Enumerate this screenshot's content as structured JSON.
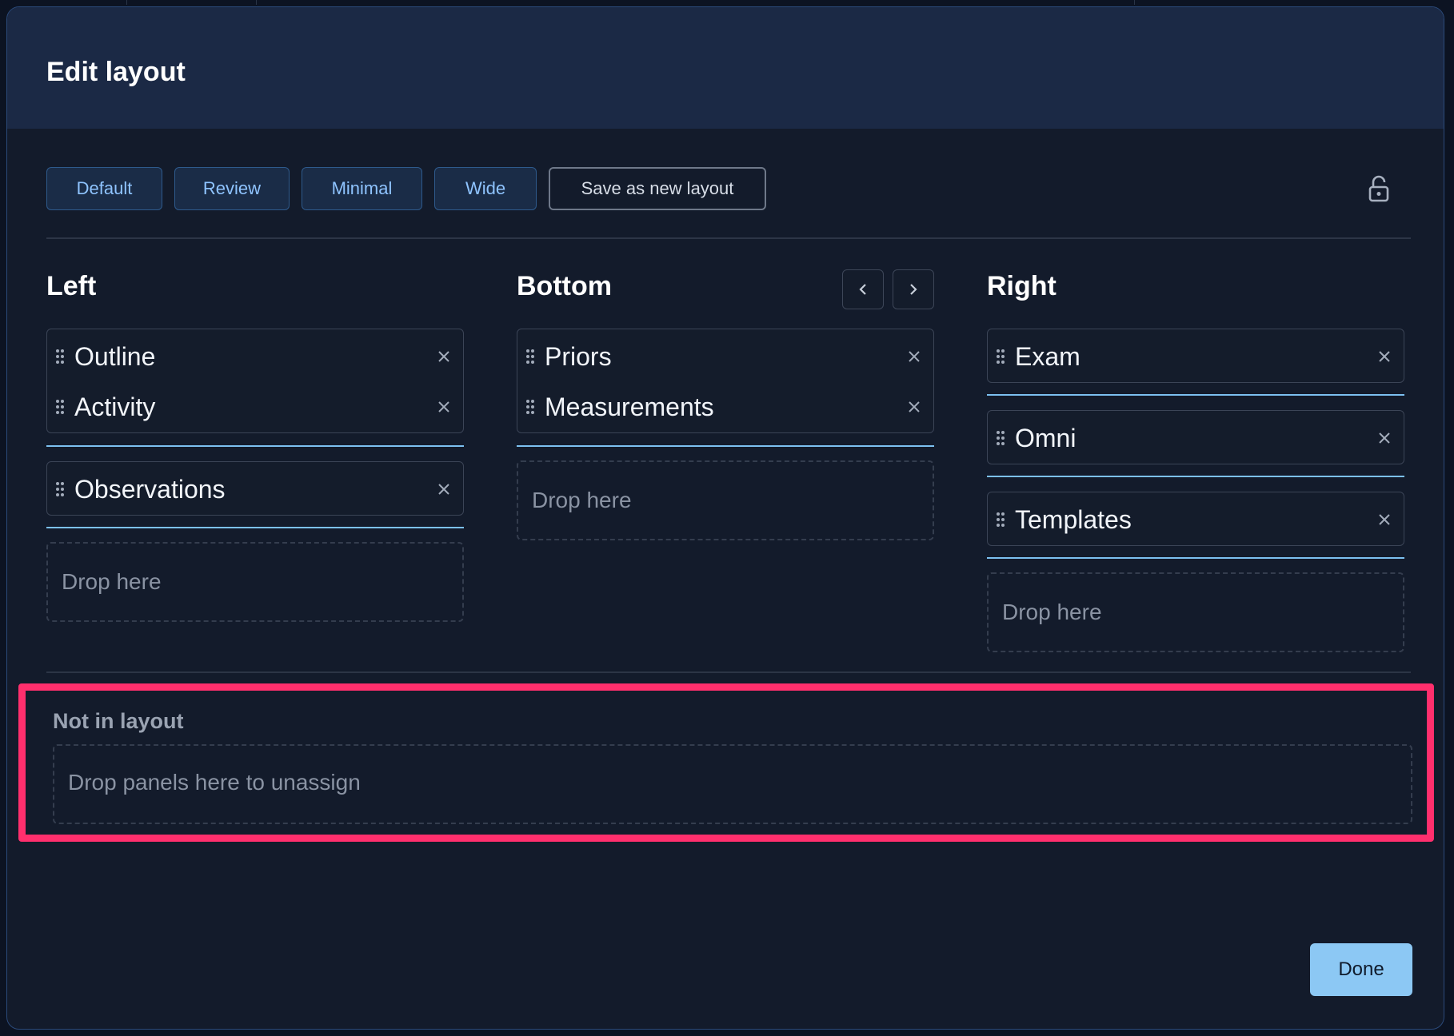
{
  "modal": {
    "title": "Edit layout"
  },
  "presets": [
    {
      "label": "Default"
    },
    {
      "label": "Review"
    },
    {
      "label": "Minimal"
    },
    {
      "label": "Wide"
    }
  ],
  "save_layout_label": "Save as new layout",
  "columns": {
    "left": {
      "title": "Left",
      "groups": [
        [
          "Outline",
          "Activity"
        ],
        [
          "Observations"
        ]
      ],
      "drop_label": "Drop here"
    },
    "bottom": {
      "title": "Bottom",
      "groups": [
        [
          "Priors",
          "Measurements"
        ]
      ],
      "drop_label": "Drop here"
    },
    "right": {
      "title": "Right",
      "groups": [
        [
          "Exam"
        ],
        [
          "Omni"
        ],
        [
          "Templates"
        ]
      ],
      "drop_label": "Drop here"
    }
  },
  "not_in_layout": {
    "title": "Not in layout",
    "drop_label": "Drop panels here to unassign"
  },
  "done_label": "Done",
  "icons": {
    "lock": "lock-open-icon",
    "drag": "drag-handle-icon",
    "close": "close-icon",
    "prev": "chevron-left-icon",
    "next": "chevron-right-icon"
  },
  "colors": {
    "accent": "#8cc8f4",
    "highlight": "#ff2f6d",
    "separator": "#7cc0f0"
  }
}
